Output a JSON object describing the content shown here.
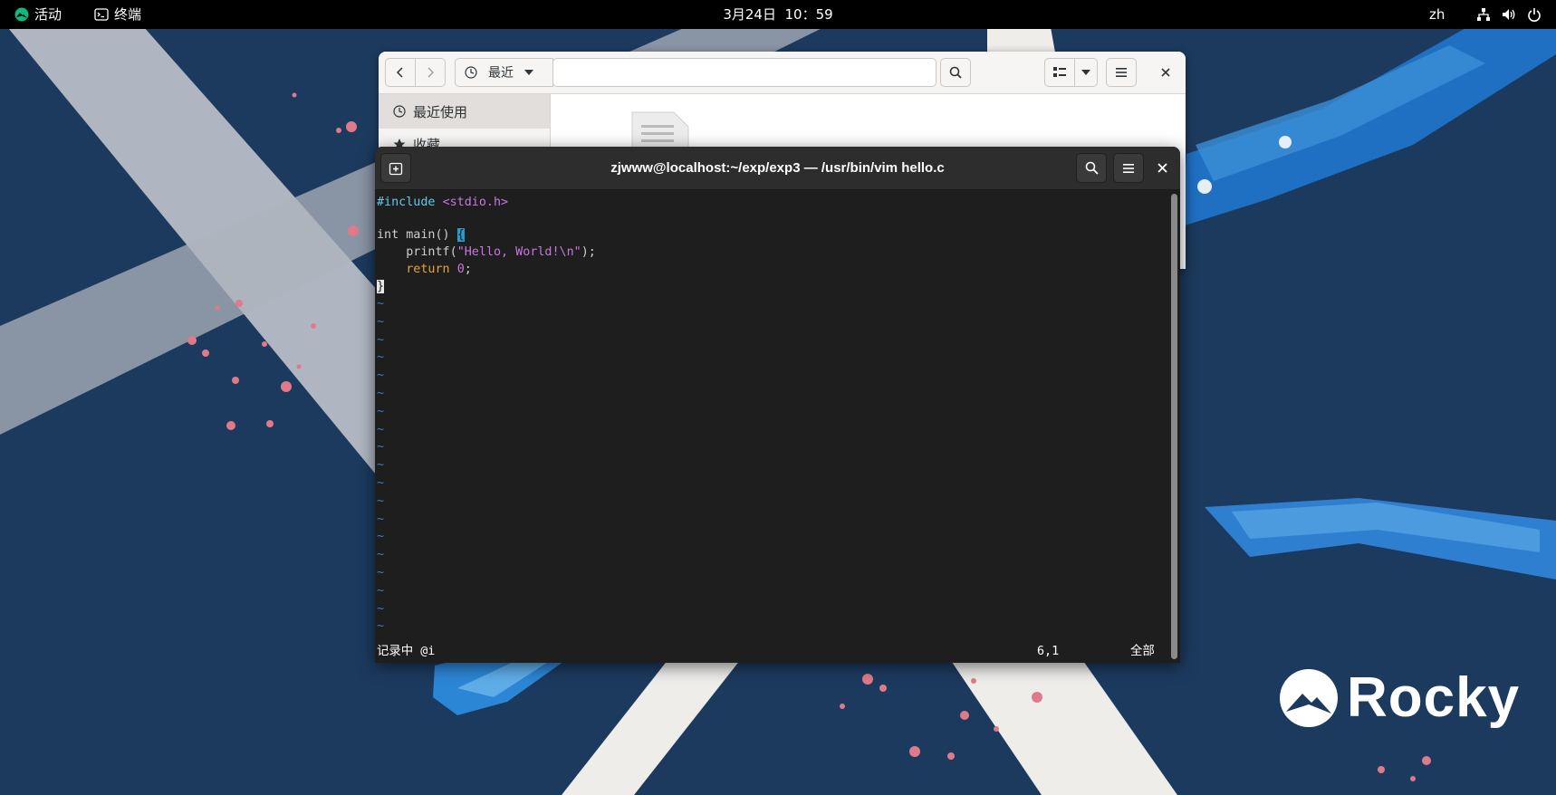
{
  "topbar": {
    "activities_label": "活动",
    "app_name": "终端",
    "clock": "3月24日  10：59",
    "language": "zh",
    "tray_icons": [
      "network-icon",
      "volume-icon",
      "power-icon"
    ]
  },
  "files_window": {
    "location_label": "最近",
    "sidebar": {
      "recent_label": "最近使用",
      "starred_label": "收藏"
    }
  },
  "terminal": {
    "title": "zjwww@localhost:~/exp/exp3 — /usr/bin/vim hello.c",
    "code": {
      "line1_directive": "#include",
      "line1_header": "<stdio.h>",
      "line3_type": "int",
      "line3_rest": " main() ",
      "line3_brace": "{",
      "line4_indent": "    ",
      "line4_func": "printf(",
      "line4_string": "\"Hello, World!\\n\"",
      "line4_end": ");",
      "line5_indent": "    ",
      "line5_keyword": "return",
      "line5_space": " ",
      "line5_number": "0",
      "line5_end": ";",
      "line6_brace": "}"
    },
    "empty_line_marker": "~",
    "status": {
      "mode": "记录中 @i",
      "position": "6,1",
      "scroll": "全部"
    }
  },
  "desktop": {
    "logo_text": "Rocky"
  },
  "colors": {
    "wallpaper": "#1c3a5e",
    "topbar": "#000000",
    "terminal_bg": "#1e1e1e",
    "preproc": "#63c8ea",
    "string": "#c678dd",
    "keyword": "#e8a33c",
    "tilde": "#3f79c8",
    "rocky_green": "#10b981"
  }
}
